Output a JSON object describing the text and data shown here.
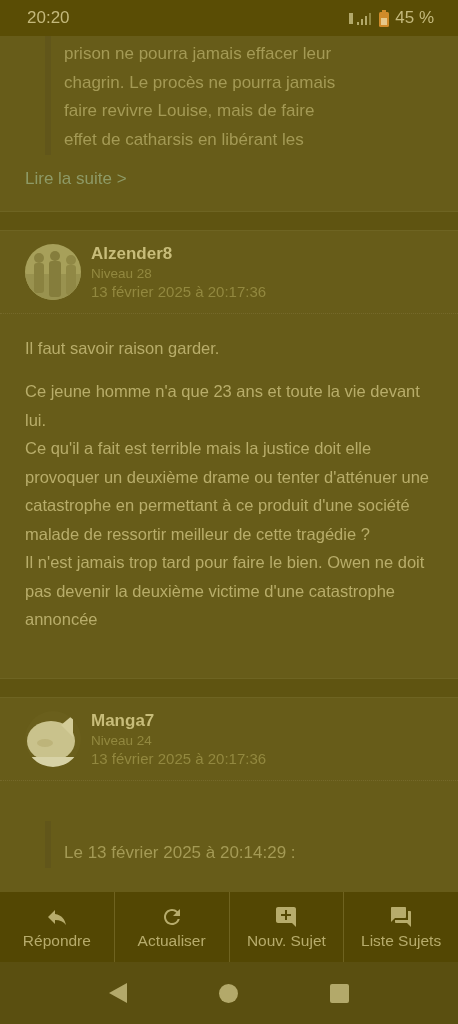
{
  "status_bar": {
    "time": "20:20",
    "battery": "45 %"
  },
  "top_quote": {
    "lines": [
      "prison ne pourra jamais effacer leur",
      "chagrin. Le procès ne pourra jamais",
      "faire revivre Louise, mais de faire",
      "effet de catharsis en libérant les"
    ],
    "read_more": "Lire la suite >"
  },
  "posts": [
    {
      "author": "Alzender8",
      "level": "Niveau 28",
      "date": "13 février 2025 à 20:17:36",
      "paragraphs": [
        [
          "Il faut savoir raison garder."
        ],
        [
          "Ce jeune homme n'a que 23 ans et toute la vie devant lui.",
          "Ce qu'il a fait est terrible mais la justice doit elle provoquer un deuxième drame ou tenter d'atténuer une catastrophe en permettant à ce produit d'une société malade de ressortir meilleur de cette tragédie ?",
          "Il n'est jamais trop tard pour faire le bien. Owen ne doit pas devenir la deuxième victime d'une catastrophe annoncée"
        ]
      ]
    },
    {
      "author": "Manga7",
      "level": "Niveau 24",
      "date": "13 février 2025 à 20:17:36",
      "quote": "Le 13 février 2025 à 20:14:29 :"
    }
  ],
  "actions": [
    {
      "kind": "reply",
      "label": "Répondre"
    },
    {
      "kind": "refresh",
      "label": "Actualiser"
    },
    {
      "kind": "new",
      "label": "Nouv. Sujet"
    },
    {
      "kind": "list",
      "label": "Liste Sujets"
    }
  ]
}
